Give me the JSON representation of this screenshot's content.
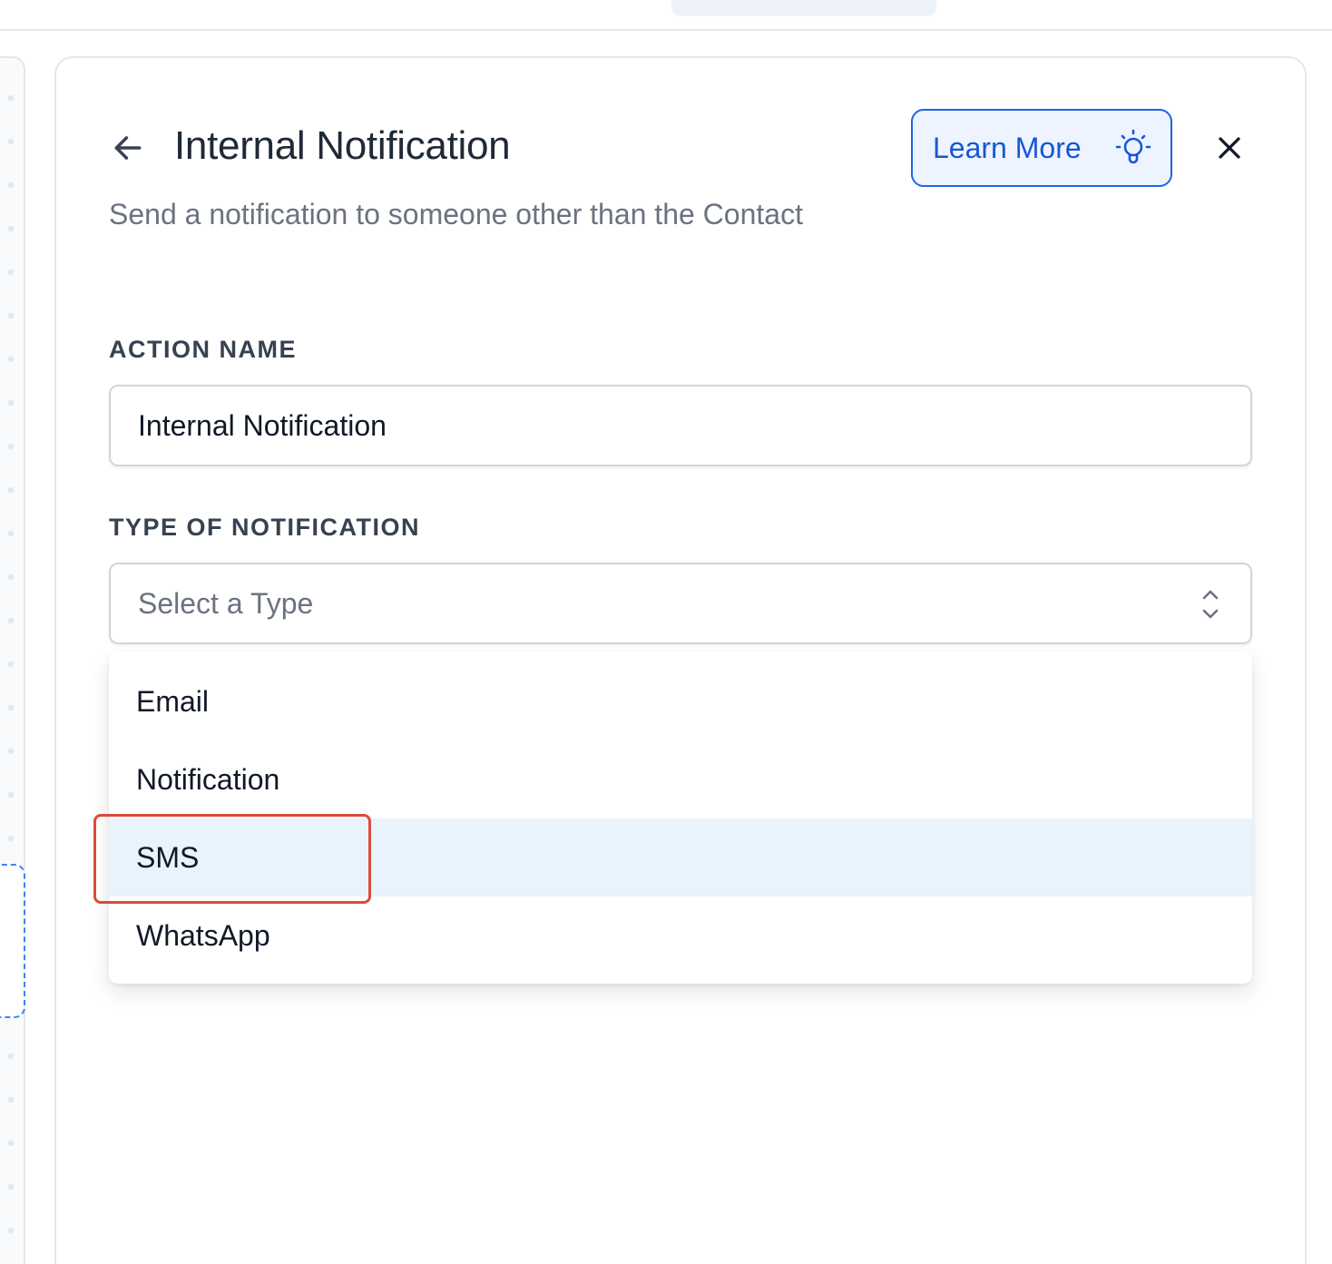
{
  "panel": {
    "title": "Internal Notification",
    "subtitle": "Send a notification to someone other than the Contact",
    "learn_more_label": "Learn More"
  },
  "form": {
    "action_name_label": "ACTION NAME",
    "action_name_value": "Internal Notification",
    "type_label": "TYPE OF NOTIFICATION",
    "type_placeholder": "Select a Type",
    "type_options": [
      "Email",
      "Notification",
      "SMS",
      "WhatsApp"
    ],
    "highlighted_option": "SMS"
  },
  "colors": {
    "accent": "#1d64e8",
    "option_highlight": "#e9f3fc",
    "annotation_box": "#dc4a3a"
  },
  "icons": [
    "arrow-left-icon",
    "lightbulb-icon",
    "close-icon",
    "chevron-up-down-icon"
  ]
}
